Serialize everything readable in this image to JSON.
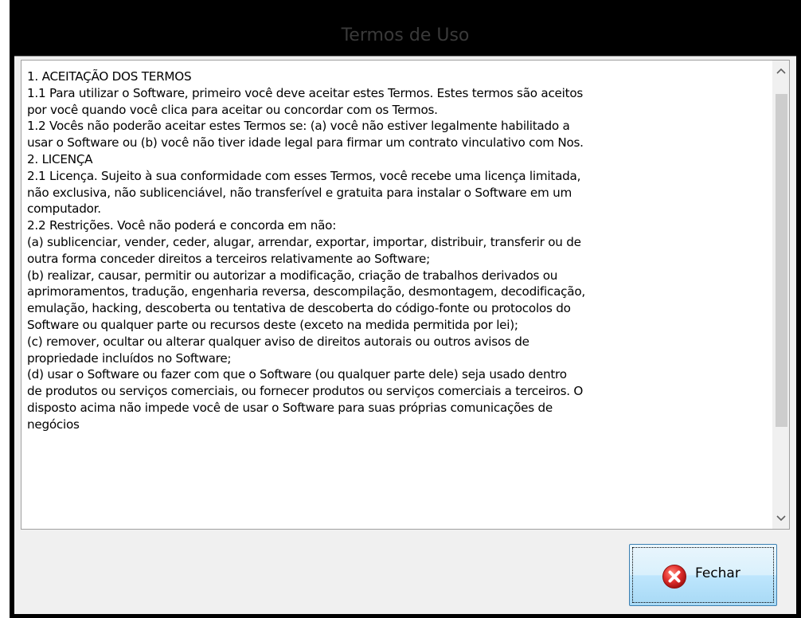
{
  "window": {
    "title": "Termos de Uso"
  },
  "terms": {
    "lines": [
      "1. ACEITAÇÃO DOS TERMOS",
      "1.1 Para utilizar o Software, primeiro você deve aceitar estes Termos. Estes termos são aceitos",
      "por você quando você clica para aceitar ou concordar com os Termos.",
      "1.2 Vocês não poderão aceitar estes Termos se: (a) você não estiver legalmente habilitado a",
      "usar o Software ou (b) você não tiver idade legal para firmar um contrato vinculativo com Nos.",
      "2. LICENÇA",
      "2.1 Licença. Sujeito à sua conformidade com esses Termos, você recebe uma licença limitada,",
      "não exclusiva, não sublicenciável, não transferível e gratuita para instalar o Software em um",
      "computador.",
      "2.2 Restrições. Você não poderá e concorda em não:",
      "(a) sublicenciar, vender, ceder, alugar, arrendar, exportar, importar, distribuir, transferir ou de",
      "outra forma conceder direitos a terceiros relativamente ao Software;",
      "(b) realizar, causar, permitir ou autorizar a modificação, criação de trabalhos derivados ou",
      "aprimoramentos, tradução, engenharia reversa, descompilação, desmontagem, decodificação,",
      "emulação, hacking, descoberta ou tentativa de descoberta do código-fonte ou protocolos do",
      "Software ou qualquer parte ou recursos deste (exceto na medida permitida por lei);",
      "(c) remover, ocultar ou alterar qualquer aviso de direitos autorais ou outros avisos de",
      "propriedade incluídos no Software;",
      "(d) usar o Software ou fazer com que o Software (ou qualquer parte dele) seja usado dentro",
      "de produtos ou serviços comerciais, ou fornecer produtos ou serviços comerciais a terceiros. O",
      "disposto acima não impede você de usar o Software para suas próprias comunicações de",
      "negócios"
    ]
  },
  "scrollbar": {
    "up_glyph": "^",
    "down_glyph": "⌄"
  },
  "buttons": {
    "close_label": "Fechar"
  },
  "colors": {
    "title_bar": "#000000",
    "title_text": "#3a3a3a",
    "close_icon": "#e3312f"
  },
  "icons": {
    "close_button_icon": "red-circle-x-icon"
  }
}
